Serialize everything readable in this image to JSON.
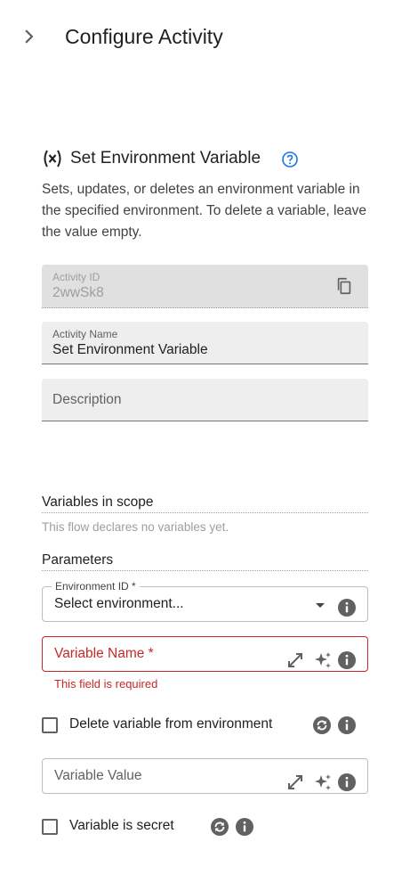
{
  "header": {
    "title": "Configure Activity",
    "toggle_icon": "chevron-right-icon"
  },
  "activity": {
    "icon": "variable-x-icon",
    "title": "Set Environment Variable",
    "help_icon": "help-circle-icon",
    "description": "Sets, updates, or deletes an environment variable in the specified environment. To delete a variable, leave the value empty."
  },
  "fields": {
    "activity_id": {
      "label": "Activity ID",
      "value": "2wwSk8",
      "icon": "copy-icon"
    },
    "activity_name": {
      "label": "Activity Name",
      "value": "Set Environment Variable"
    },
    "description": {
      "placeholder": "Description"
    }
  },
  "variables_in_scope": {
    "heading": "Variables in scope",
    "note": "This flow declares no variables yet."
  },
  "parameters": {
    "heading": "Parameters",
    "environment_id": {
      "label": "Environment ID *",
      "value": "Select environment...",
      "icons": [
        "dropdown-arrow-icon",
        "info-icon"
      ]
    },
    "variable_name": {
      "placeholder": "Variable Name *",
      "error": "This field is required",
      "icons": [
        "expand-icon",
        "sparkle-icon",
        "info-icon"
      ]
    },
    "delete_variable": {
      "label": "Delete variable from environment",
      "checked": false,
      "icons": [
        "sync-icon",
        "info-icon"
      ]
    },
    "variable_value": {
      "placeholder": "Variable Value",
      "icons": [
        "expand-icon",
        "sparkle-icon",
        "info-icon"
      ]
    },
    "variable_secret": {
      "label": "Variable is secret",
      "checked": false,
      "icons": [
        "sync-icon",
        "info-icon"
      ]
    }
  },
  "colors": {
    "error": "#c62828",
    "accent": "#1a73e8",
    "icon": "#616161"
  }
}
